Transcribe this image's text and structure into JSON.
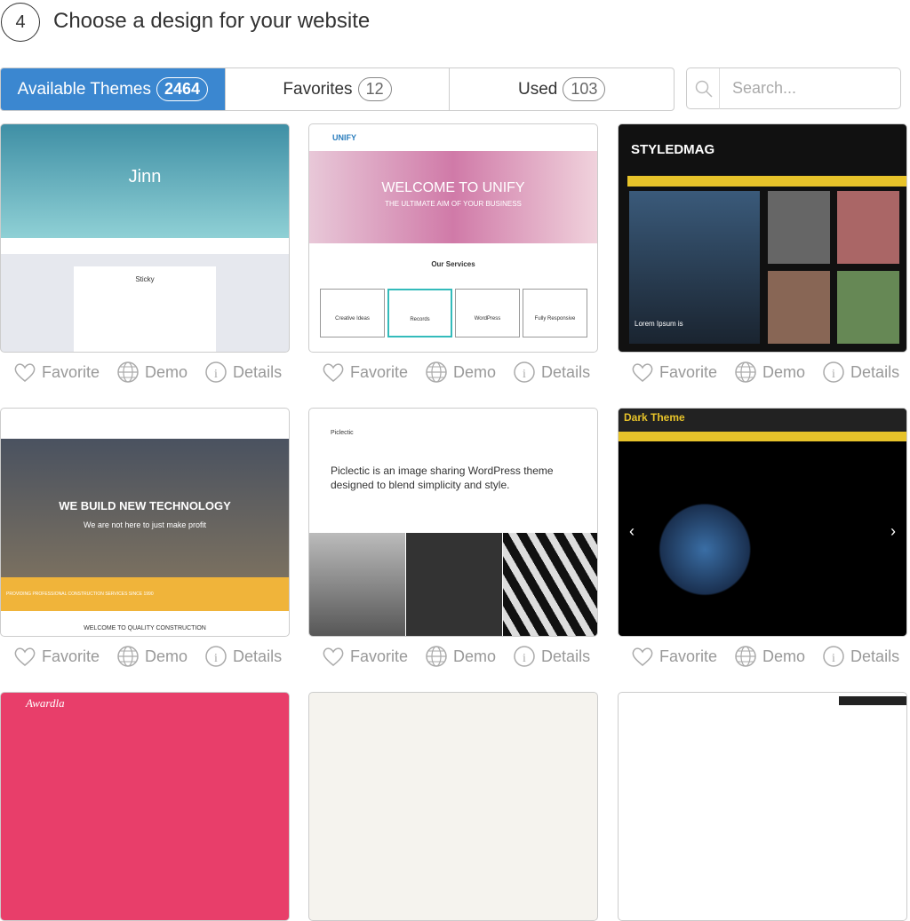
{
  "step": "4",
  "title": "Choose a design for your website",
  "tabs": [
    {
      "label": "Available Themes",
      "count": "2464",
      "active": true
    },
    {
      "label": "Favorites",
      "count": "12"
    },
    {
      "label": "Used",
      "count": "103"
    }
  ],
  "search": {
    "placeholder": "Search..."
  },
  "actions": {
    "favorite": "Favorite",
    "demo": "Demo",
    "details": "Details"
  },
  "colors": {
    "accent": "#3b87d0"
  },
  "themes": [
    {
      "name": "Jinn",
      "texts": [
        "Jinn",
        "Sticky"
      ]
    },
    {
      "name": "Unify",
      "texts": [
        "UNIFY",
        "WELCOME TO UNIFY",
        "THE ULTIMATE AIM OF YOUR BUSINESS",
        "Our Services",
        "Creative Ideas",
        "Records",
        "WordPress",
        "Fully Responsive"
      ]
    },
    {
      "name": "StyledMag",
      "texts": [
        "STYLEDMAG",
        "Lorem Ipsum is"
      ]
    },
    {
      "name": "Construction",
      "texts": [
        "WE BUILD NEW TECHNOLOGY",
        "We are not here to just make profit",
        "PROVIDING PROFESSIONAL CONSTRUCTION SERVICES SINCE 1990",
        "WELCOME TO QUALITY CONSTRUCTION"
      ]
    },
    {
      "name": "Piclectic",
      "texts": [
        "Piclectic",
        "Piclectic is an image sharing WordPress theme designed to blend simplicity and style."
      ]
    },
    {
      "name": "Dark Theme",
      "texts": [
        "Dark Theme"
      ]
    },
    {
      "name": "Awardla",
      "texts": [
        "Awardla"
      ]
    }
  ]
}
